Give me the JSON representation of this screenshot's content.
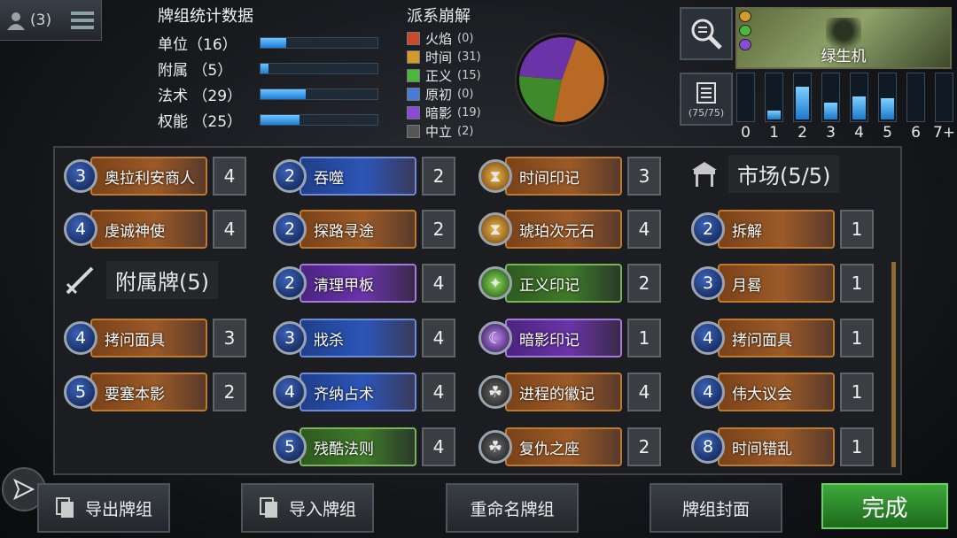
{
  "user": {
    "count_label": "(3)"
  },
  "stats": {
    "title": "牌组统计数据",
    "rows": [
      {
        "label": "单位（16）",
        "fraction": 0.22
      },
      {
        "label": "附属 （5）",
        "fraction": 0.07
      },
      {
        "label": "法术 （29）",
        "fraction": 0.39
      },
      {
        "label": "权能 （25）",
        "fraction": 0.33
      }
    ]
  },
  "breakdown": {
    "title": "派系崩解",
    "items": [
      {
        "name": "火焰",
        "count": "(0)",
        "color": "#c84a2a",
        "icon": "flame-icon"
      },
      {
        "name": "时间",
        "count": "(31)",
        "color": "#d49a2a",
        "icon": "hourglass-icon"
      },
      {
        "name": "正义",
        "count": "(15)",
        "color": "#4ab83a",
        "icon": "justice-icon"
      },
      {
        "name": "原初",
        "count": "(0)",
        "color": "#4a7ad8",
        "icon": "primal-icon"
      },
      {
        "name": "暗影",
        "count": "(19)",
        "color": "#8a4ad8",
        "icon": "shadow-icon"
      },
      {
        "name": "中立",
        "count": "(2)",
        "color": "#555555",
        "icon": "neutral-icon"
      }
    ],
    "pie": [
      {
        "value": 31,
        "color": "#b86a24"
      },
      {
        "value": 15,
        "color": "#3f8a2a"
      },
      {
        "value": 19,
        "color": "#6a34a8"
      }
    ]
  },
  "hero": {
    "name": "绿生机"
  },
  "deck_count": "(75/75)",
  "curve": {
    "labels": [
      "0",
      "1",
      "2",
      "3",
      "4",
      "5",
      "6",
      "7+"
    ],
    "levels": [
      0.0,
      0.18,
      0.68,
      0.35,
      0.48,
      0.45,
      0.0,
      0.0
    ]
  },
  "sections": {
    "attachments": "附属牌(5)",
    "market": "市场(5/5)"
  },
  "cards": {
    "col1": [
      {
        "cost": "3",
        "name": "奥拉利安商人",
        "qty": "4",
        "style": "orange"
      },
      {
        "cost": "4",
        "name": "虔诚神使",
        "qty": "4",
        "style": "orange"
      }
    ],
    "col1_attach": [
      {
        "cost": "4",
        "name": "拷问面具",
        "qty": "3",
        "style": "orange"
      },
      {
        "cost": "5",
        "name": "要塞本影",
        "qty": "2",
        "style": "orange"
      }
    ],
    "col2": [
      {
        "cost": "2",
        "name": "吞噬",
        "qty": "2",
        "style": "blue"
      },
      {
        "cost": "2",
        "name": "探路寻途",
        "qty": "2",
        "style": "orange"
      },
      {
        "cost": "2",
        "name": "清理甲板",
        "qty": "4",
        "style": "purple"
      },
      {
        "cost": "3",
        "name": "戕杀",
        "qty": "4",
        "style": "blue"
      },
      {
        "cost": "4",
        "name": "齐纳占术",
        "qty": "4",
        "style": "blue"
      },
      {
        "cost": "5",
        "name": "残酷法则",
        "qty": "4",
        "style": "green"
      }
    ],
    "col3": [
      {
        "icon": "hourglass",
        "name": "时间印记",
        "qty": "3",
        "style": "orange"
      },
      {
        "icon": "hourglass",
        "name": "琥珀次元石",
        "qty": "4",
        "style": "orange"
      },
      {
        "icon": "justice",
        "name": "正义印记",
        "qty": "2",
        "style": "green"
      },
      {
        "icon": "shadow",
        "name": "暗影印记",
        "qty": "1",
        "style": "purple"
      },
      {
        "icon": "triquetra",
        "name": "进程的徽记",
        "qty": "4",
        "style": "orange"
      },
      {
        "icon": "triquetra",
        "name": "复仇之座",
        "qty": "2",
        "style": "orange"
      }
    ],
    "col4": [
      {
        "cost": "2",
        "name": "拆解",
        "qty": "1",
        "style": "orange"
      },
      {
        "cost": "3",
        "name": "月晷",
        "qty": "1",
        "style": "orange"
      },
      {
        "cost": "4",
        "name": "拷问面具",
        "qty": "1",
        "style": "orange"
      },
      {
        "cost": "4",
        "name": "伟大议会",
        "qty": "1",
        "style": "orange"
      },
      {
        "cost": "8",
        "name": "时间错乱",
        "qty": "1",
        "style": "orange"
      }
    ]
  },
  "buttons": {
    "export": "导出牌组",
    "import": "导入牌组",
    "rename": "重命名牌组",
    "cover": "牌组封面",
    "done": "完成"
  }
}
